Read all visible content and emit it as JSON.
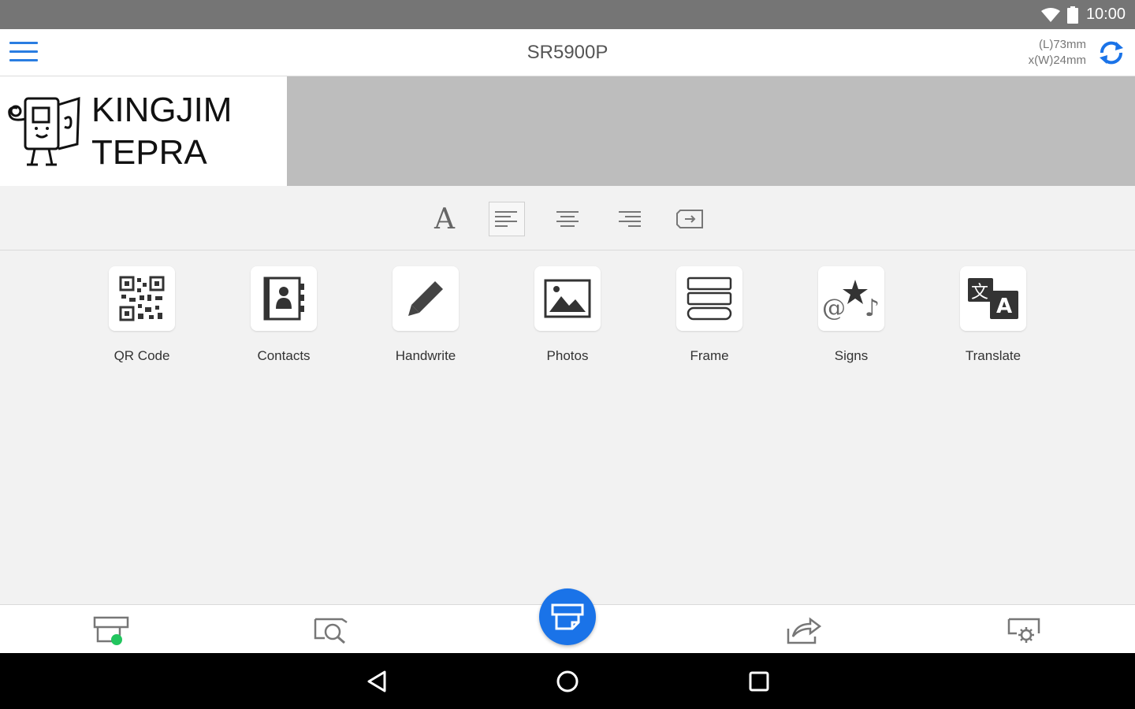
{
  "status_bar": {
    "time": "10:00"
  },
  "app_bar": {
    "title": "SR5900P",
    "tape_length": "(L)73mm",
    "tape_width": "x(W)24mm"
  },
  "label": {
    "line1": "KINGJIM",
    "line2": "TEPRA"
  },
  "format_toolbar": {
    "font_glyph": "A",
    "active_alignment": "left"
  },
  "tools": [
    {
      "label": "QR Code",
      "icon": "qr-code-icon"
    },
    {
      "label": "Contacts",
      "icon": "contacts-icon"
    },
    {
      "label": "Handwrite",
      "icon": "pencil-icon"
    },
    {
      "label": "Photos",
      "icon": "photo-icon"
    },
    {
      "label": "Frame",
      "icon": "frame-icon"
    },
    {
      "label": "Signs",
      "icon": "signs-icon"
    },
    {
      "label": "Translate",
      "icon": "translate-icon"
    }
  ],
  "bottom_bar": [
    "printer-status-icon",
    "preview-search-icon",
    "print-icon",
    "share-icon",
    "settings-icon"
  ],
  "colors": {
    "accent": "#1a73e8",
    "status_bar": "#757575",
    "connected": "#22c55e"
  }
}
